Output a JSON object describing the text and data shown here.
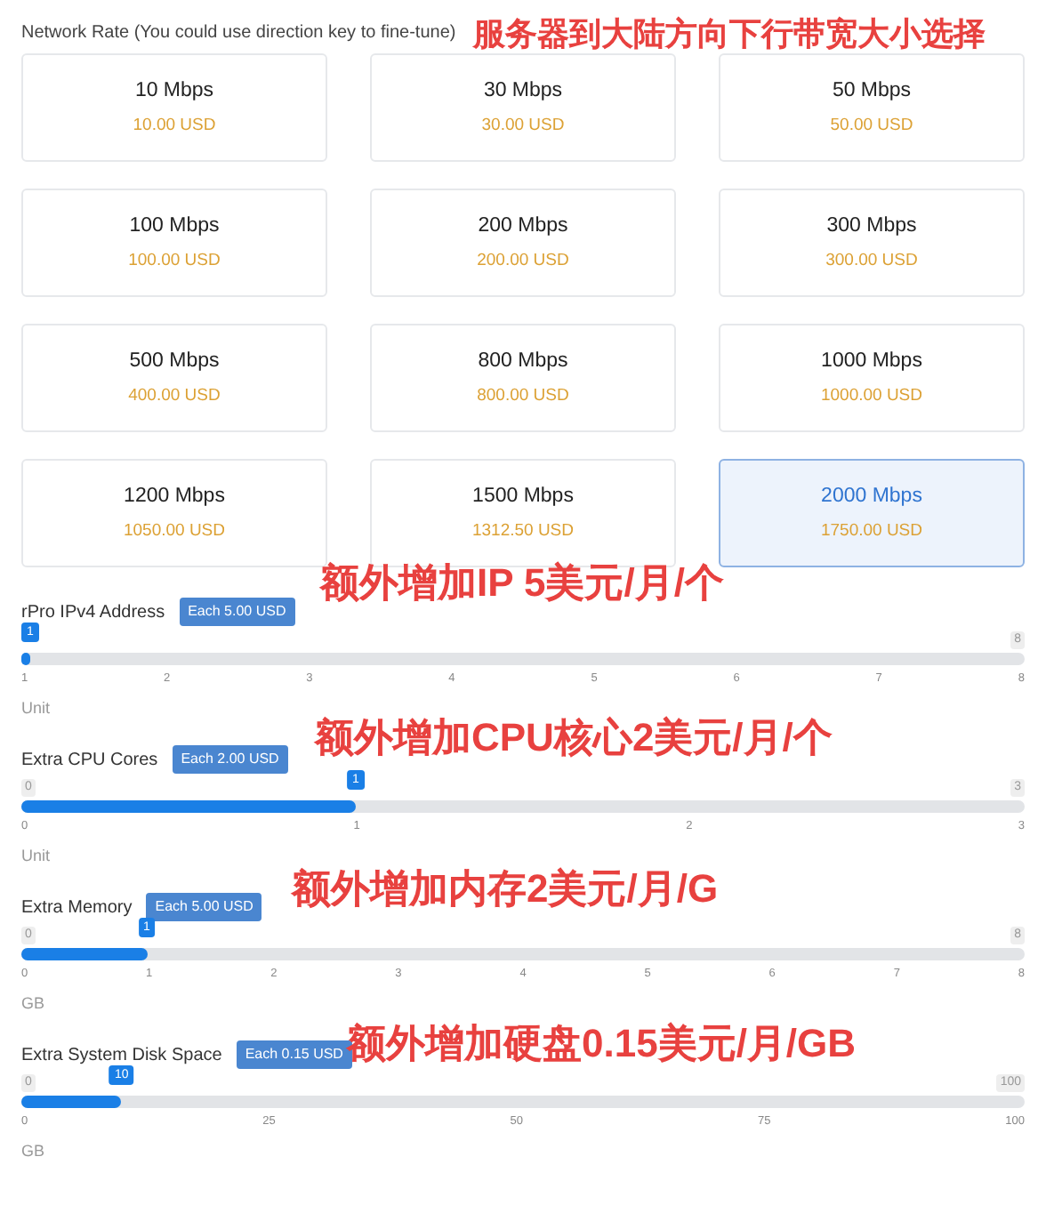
{
  "network_rate": {
    "heading": "Network Rate (You could use direction key to fine-tune)",
    "annotation": "服务器到大陆方向下行带宽大小选择",
    "options": [
      {
        "speed": "10 Mbps",
        "price": "10.00 USD",
        "selected": false
      },
      {
        "speed": "30 Mbps",
        "price": "30.00 USD",
        "selected": false
      },
      {
        "speed": "50 Mbps",
        "price": "50.00 USD",
        "selected": false
      },
      {
        "speed": "100 Mbps",
        "price": "100.00 USD",
        "selected": false
      },
      {
        "speed": "200 Mbps",
        "price": "200.00 USD",
        "selected": false
      },
      {
        "speed": "300 Mbps",
        "price": "300.00 USD",
        "selected": false
      },
      {
        "speed": "500 Mbps",
        "price": "400.00 USD",
        "selected": false
      },
      {
        "speed": "800 Mbps",
        "price": "800.00 USD",
        "selected": false
      },
      {
        "speed": "1000 Mbps",
        "price": "1000.00 USD",
        "selected": false
      },
      {
        "speed": "1200 Mbps",
        "price": "1050.00 USD",
        "selected": false
      },
      {
        "speed": "1500 Mbps",
        "price": "1312.50 USD",
        "selected": false
      },
      {
        "speed": "2000 Mbps",
        "price": "1750.00 USD",
        "selected": true
      }
    ]
  },
  "addons": [
    {
      "label": "rPro IPv4 Address",
      "badge": "Each 5.00 USD",
      "annotation": "额外增加IP 5美元/月/个",
      "max": "8",
      "value": "1",
      "level": 0,
      "ticks": [
        "1",
        "2",
        "3",
        "4",
        "5",
        "6",
        "7",
        "8"
      ],
      "unit": "Unit"
    },
    {
      "label": "Extra CPU Cores",
      "badge": "Each 2.00 USD",
      "annotation": "额外增加CPU核心2美元/月/个",
      "min": "0",
      "max": "3",
      "value": "1",
      "level": 0.3333,
      "ticks": [
        "0",
        "1",
        "2",
        "3"
      ],
      "unit": "Unit"
    },
    {
      "label": "Extra Memory",
      "badge": "Each 5.00 USD",
      "annotation": "额外增加内存2美元/月/G",
      "min": "0",
      "max": "8",
      "value": "1",
      "level": 0.125,
      "ticks": [
        "0",
        "1",
        "2",
        "3",
        "4",
        "5",
        "6",
        "7",
        "8"
      ],
      "unit": "GB"
    },
    {
      "label": "Extra System Disk Space",
      "badge": "Each 0.15 USD",
      "annotation": "额外增加硬盘0.15美元/月/GB",
      "min": "0",
      "max": "100",
      "value": "10",
      "level": 0.1,
      "ticks": [
        "0",
        "25",
        "50",
        "75",
        "100"
      ],
      "unit": "GB"
    }
  ]
}
